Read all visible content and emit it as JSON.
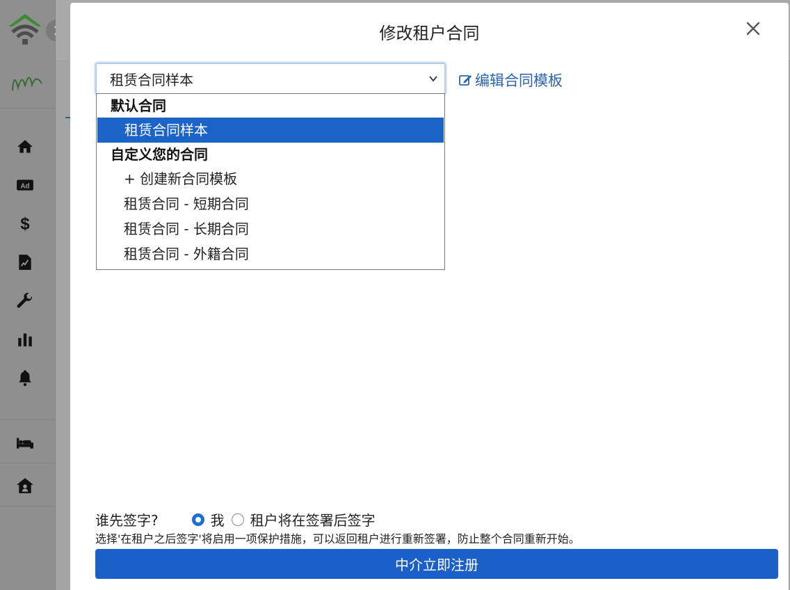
{
  "modal": {
    "title": "修改租户合同",
    "close_icon": "close-icon"
  },
  "contract_select": {
    "selected_value": "租赁合同样本",
    "chevron_icon": "chevron-down-icon"
  },
  "edit_template": {
    "icon": "edit-icon",
    "label": "编辑合同模板"
  },
  "dropdown": {
    "group_default": "默认合同",
    "option_sample": "租赁合同样本",
    "group_custom": "自定义您的合同",
    "option_create": "+ 创建新合同模板",
    "option_short": "租赁合同 - 短期合同",
    "option_long": "租赁合同 - 长期合同",
    "option_foreign": "租赁合同 - 外籍合同"
  },
  "sign_order": {
    "question": "谁先签字?",
    "option_me": "我",
    "option_tenant": "租户将在签署后签字",
    "selected": "me"
  },
  "hint": "选择'在租户之后签字'将启用一项保护措施，可以返回租户进行重新签署，防止整个合同重新开始。",
  "submit_label": "中介立即注册",
  "colors": {
    "primary": "#1b5fc9",
    "link": "#2a64ad",
    "selected_option": "#1b63c7"
  },
  "sidebar": {
    "icons": [
      "home-icon",
      "ad-icon",
      "dollar-icon",
      "contract-sign-icon",
      "wrench-icon",
      "bar-chart-icon",
      "bell-icon",
      "bed-icon",
      "house-user-icon"
    ]
  }
}
